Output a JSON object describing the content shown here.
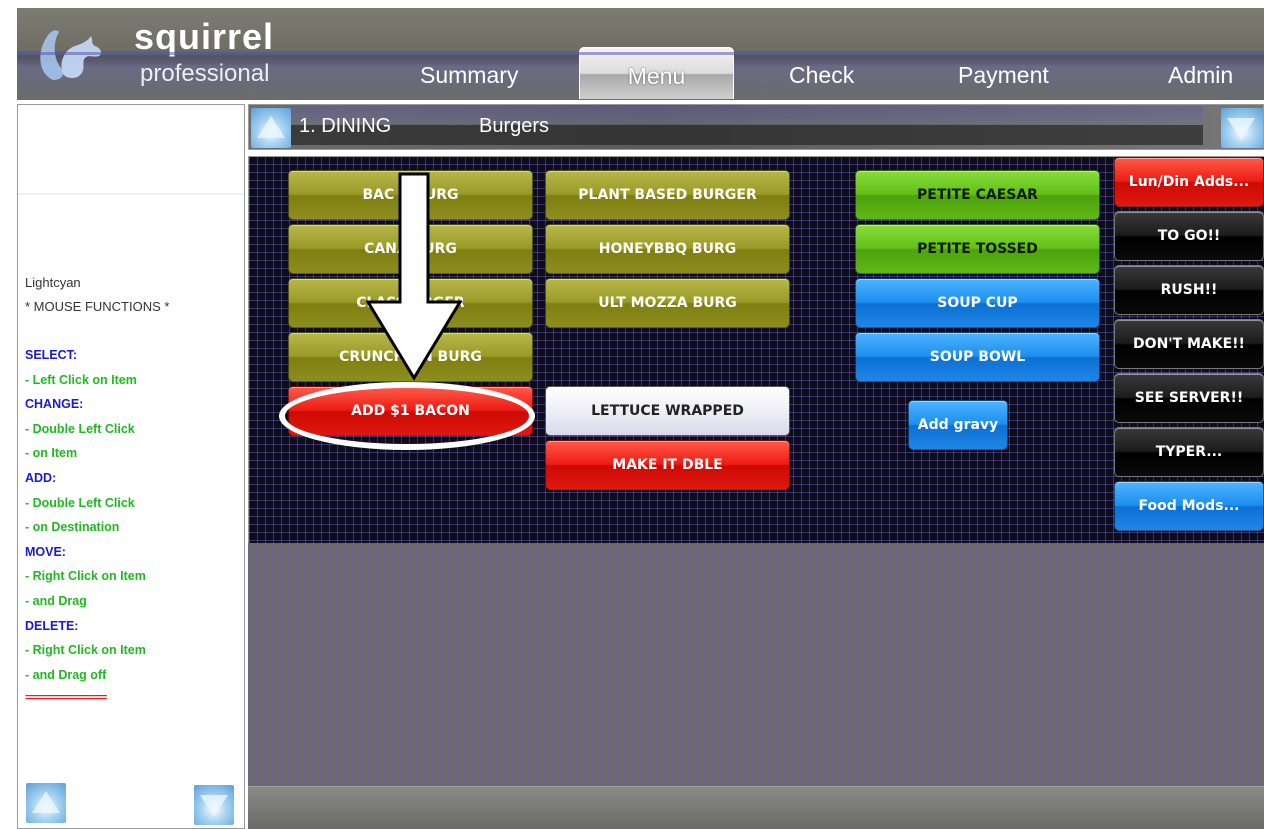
{
  "header": {
    "logo_title": "squirrel",
    "logo_subtitle": "professional",
    "tabs": [
      {
        "label": "Summary"
      },
      {
        "label": "Menu",
        "active": true
      },
      {
        "label": "Check"
      },
      {
        "label": "Payment"
      },
      {
        "label": "Admin"
      }
    ]
  },
  "sidebar": {
    "color_name": "Lightcyan",
    "heading": "* MOUSE FUNCTIONS *",
    "lines": [
      {
        "text": "SELECT:",
        "style": "head"
      },
      {
        "text": " - Left Click on Item",
        "style": "item"
      },
      {
        "text": "CHANGE:",
        "style": "head"
      },
      {
        "text": " - Double Left Click",
        "style": "item"
      },
      {
        "text": " - on Item",
        "style": "item"
      },
      {
        "text": "ADD:",
        "style": "head"
      },
      {
        "text": " - Double Left Click",
        "style": "item"
      },
      {
        "text": " - on Destination",
        "style": "item"
      },
      {
        "text": "MOVE:",
        "style": "head"
      },
      {
        "text": " - Right Click on Item",
        "style": "item"
      },
      {
        "text": " - and Drag",
        "style": "item"
      },
      {
        "text": "DELETE:",
        "style": "head"
      },
      {
        "text": " - Right Click on Item",
        "style": "item"
      },
      {
        "text": " - and Drag off",
        "style": "item"
      },
      {
        "text": "===============",
        "style": "sep"
      }
    ]
  },
  "breadcrumb": {
    "section": "1. DINING",
    "category": "Burgers"
  },
  "menu_buttons": {
    "bac_burg": "BAC C      BURG",
    "plant_based": "PLANT BASED BURGER",
    "petite_caesar": "PETITE CAESAR",
    "canadian_burg": "CANA      BURG",
    "honeybbq": "HONEYBBQ BURG",
    "petite_tossed": "PETITE TOSSED",
    "classic_burger": "CLASS      URGER",
    "ult_mozza": "ULT MOZZA BURG",
    "soup_cup": "SOUP CUP",
    "crunch_burg": "CRUNCH      AN BURG",
    "soup_bowl": "SOUP BOWL",
    "add_bacon": "ADD $1 BACON",
    "lettuce_wrapped": "LETTUCE WRAPPED",
    "add_gravy": "Add gravy",
    "make_dble": "MAKE IT DBLE"
  },
  "side_buttons": {
    "lun_din_adds": "Lun/Din Adds...",
    "to_go": "TO GO!!",
    "rush": "RUSH!!",
    "dont_make": "DON'T MAKE!!",
    "see_server": "SEE SERVER!!",
    "typer": "TYPER...",
    "food_mods": "Food Mods..."
  },
  "colors": {
    "olive_button": "#9a9a28",
    "green_button": "#62c018",
    "blue_button": "#1c8ff0",
    "red_button": "#ee1c14",
    "black_button": "#000000",
    "grid_background": "#0c0c1c",
    "sidebar_head": "#1a1ad0",
    "sidebar_item": "#22b822"
  }
}
